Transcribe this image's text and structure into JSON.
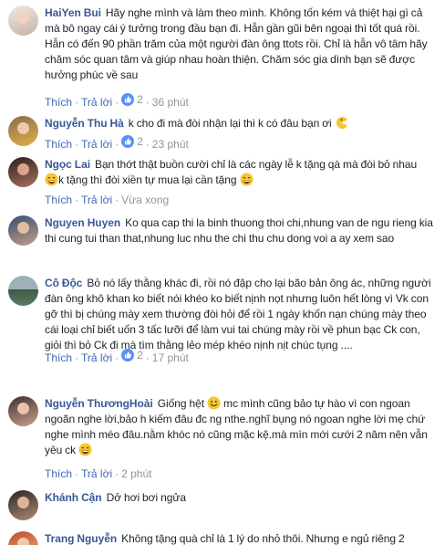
{
  "actions": {
    "like": "Thích",
    "reply": "Trả lời",
    "dot": "·"
  },
  "comments": [
    {
      "name": "HaiYen Bui",
      "text": "Hãy nghe mình và làm theo mình. Không tốn kém và thiệt hại gì cả mà bô ngay cái ý tưởng trong đầu bạn đi. Hẫn gần gũi bên ngoại thì tốt quá rồi. Hẫn có đến 90 phần trăm của một người đàn ông ttots rồi. Chỉ là hẫn vô tâm hãy chăm sóc quan tâm và giúp nhau hoàn thiện. Chăm sóc gia dình bạn sẽ được hưởng phúc về sau",
      "likes": "2",
      "time": "36 phút",
      "avatar_colors": [
        "#e9e2dc",
        "#b49b8d"
      ]
    },
    {
      "name": "Nguyễn Thu Hà",
      "text": "k cho đi mà đòi nhận lại thì k có đâu bạn ơi",
      "likes": "2",
      "time": "23 phút",
      "avatar_colors": [
        "#7a5a4a",
        "#d9a843"
      ]
    },
    {
      "name": "Ngọc Lai",
      "text": "Bạn thớt thật buồn cười chỉ là các ngày lễ k tặng qà mà đòi bỏ nhau",
      "text2": "k tặng thì đòi xiền tự mua lại cần tặng",
      "time": "Vừa xong",
      "avatar_colors": [
        "#3a2622",
        "#9a6b5a"
      ]
    },
    {
      "name": "Nguyen Huyen",
      "text": "Ko qua cap thi la binh thuong thoi chi,nhung van de ngu rieng kia thi cung tui than that,nhung luc nhu the chi thu chu dong voi a ay xem sao",
      "avatar_colors": [
        "#2e4a6c",
        "#c9a38a"
      ]
    },
    {
      "name": "Cô Độc",
      "text": "Bỏ nó lấy thằng khác đi, rồi nó đập cho lại bão bản ông ác, những người đàn ông khô khan ko biết nói khéo ko biết nịnh nọt nhưng luôn hết lòng vì Vk con gỡ thì bị chúng mày xem thường đòi hỏi để rồi 1 ngày khốn nạn chúng mày theo cái loại chỉ biết uốn 3 tấc lưỡi để làm vui tai chúng mày rồi về phun bạc Ck con, giỏi thì bỏ Ck đi mà tìm thằng lẻo mép khéo nịnh nịt chúc tụng ....",
      "likes": "2",
      "time": "17 phút",
      "avatar_colors": [
        "#4a6a55",
        "#8fa2a8"
      ]
    },
    {
      "name": "Nguyễn ThươngHoài",
      "text_a": "Giống hệt",
      "text_b": "mc mình cũng bảo tự hào vì con ngoan ngoãn nghe lời,bảo h kiếm đâu đc ng nthe.nghĩ bụng nó ngoan nghe lời mẹ chứ nghe mình méo đâu.nằm khóc nó cũng mặc kệ.mà mìn mới cưới 2 năm nên vẫn yêu ck",
      "time": "2 phút",
      "avatar_colors": [
        "#4a3a35",
        "#c48f7c"
      ]
    },
    {
      "name": "Khánh Cận",
      "text": "Dở hơi bơi ngửa",
      "avatar_colors": [
        "#2c2c2c",
        "#b88d76"
      ]
    },
    {
      "name": "Trang Nguyễn",
      "text": "Không tặng quà chỉ là 1 lý do nhỏ thôi. Nhưng e ngủ riêng 2",
      "avatar_colors": [
        "#b9472e",
        "#e5b48a"
      ]
    }
  ],
  "colors": {
    "name": "#385898",
    "link": "#4267b2",
    "meta": "#90949c",
    "like_blue": "#5890ff"
  },
  "icons": {
    "like_badge": "thumbs-up-badge-icon",
    "emoji_smile": "grinning-emoji-icon",
    "emoji_laugh": "laughing-emoji-icon",
    "emoji_pacman": "pacman-emoji-icon"
  }
}
